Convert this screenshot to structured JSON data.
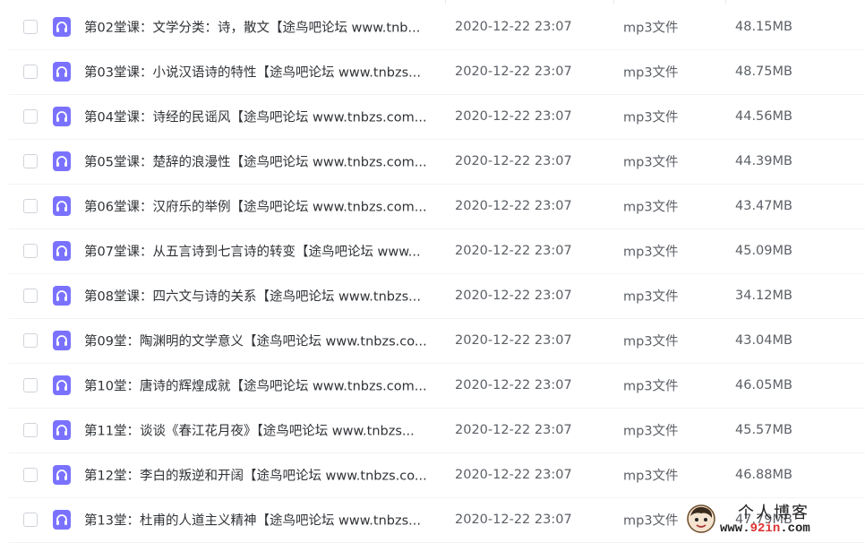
{
  "columns": {
    "dividers": [
      "name-date",
      "date-type",
      "type-size"
    ]
  },
  "files": [
    {
      "name": "第02堂课：文学分类：诗，散文【途鸟吧论坛 www.tnb...",
      "modified": "2020-12-22 23:07",
      "type": "mp3文件",
      "size": "48.15MB"
    },
    {
      "name": "第03堂课：小说汉语诗的特性【途鸟吧论坛 www.tnbzs...",
      "modified": "2020-12-22 23:07",
      "type": "mp3文件",
      "size": "48.75MB"
    },
    {
      "name": "第04堂课：诗经的民谣风【途鸟吧论坛 www.tnbzs.com...",
      "modified": "2020-12-22 23:07",
      "type": "mp3文件",
      "size": "44.56MB"
    },
    {
      "name": "第05堂课：楚辞的浪漫性【途鸟吧论坛 www.tnbzs.com...",
      "modified": "2020-12-22 23:07",
      "type": "mp3文件",
      "size": "44.39MB"
    },
    {
      "name": "第06堂课：汉府乐的举例【途鸟吧论坛 www.tnbzs.com...",
      "modified": "2020-12-22 23:07",
      "type": "mp3文件",
      "size": "43.47MB"
    },
    {
      "name": "第07堂课：从五言诗到七言诗的转变【途鸟吧论坛 www...",
      "modified": "2020-12-22 23:07",
      "type": "mp3文件",
      "size": "45.09MB"
    },
    {
      "name": "第08堂课：四六文与诗的关系【途鸟吧论坛 www.tnbzs...",
      "modified": "2020-12-22 23:07",
      "type": "mp3文件",
      "size": "34.12MB"
    },
    {
      "name": "第09堂：陶渊明的文学意义【途鸟吧论坛 www.tnbzs.co...",
      "modified": "2020-12-22 23:07",
      "type": "mp3文件",
      "size": "43.04MB"
    },
    {
      "name": "第10堂：唐诗的辉煌成就【途鸟吧论坛 www.tnbzs.com...",
      "modified": "2020-12-22 23:07",
      "type": "mp3文件",
      "size": "46.05MB"
    },
    {
      "name": "第11堂：谈谈《春江花月夜》【途鸟吧论坛 www.tnbzs...",
      "modified": "2020-12-22 23:07",
      "type": "mp3文件",
      "size": "45.57MB"
    },
    {
      "name": "第12堂：李白的叛逆和开阔【途鸟吧论坛 www.tnbzs.co...",
      "modified": "2020-12-22 23:07",
      "type": "mp3文件",
      "size": "46.88MB"
    },
    {
      "name": "第13堂：杜甫的人道主义精神【途鸟吧论坛 www.tnbzs...",
      "modified": "2020-12-22 23:07",
      "type": "mp3文件",
      "size": "47.79MB"
    }
  ],
  "icons": {
    "row_checkbox": "checkbox-icon",
    "file_type": "audio-file-icon"
  },
  "colors": {
    "audio_icon": "#7a72ff",
    "row_divider": "#f2f3f5",
    "name_text": "#2f3236",
    "meta_text": "#5c6066"
  },
  "watermark": {
    "title": "个人博客",
    "url_prefix": "www.",
    "url_accent": "92in",
    "url_suffix": ".com"
  }
}
